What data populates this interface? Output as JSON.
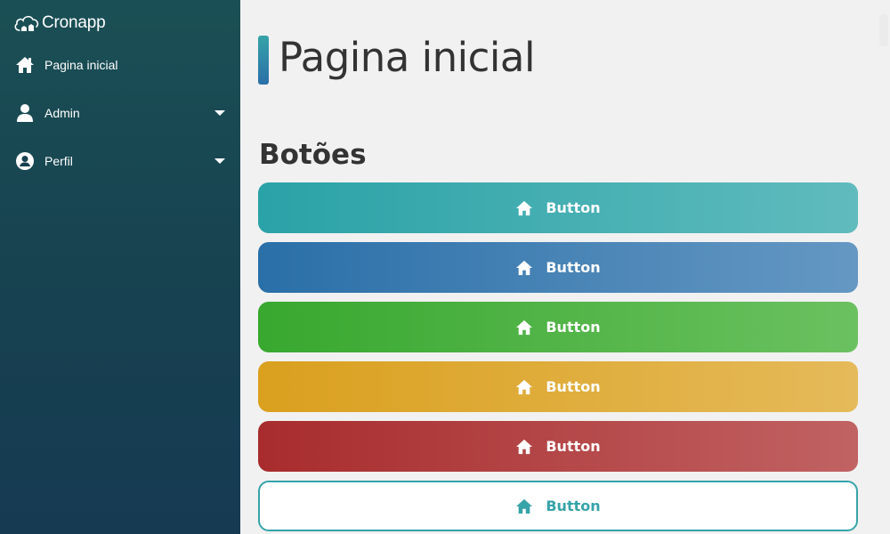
{
  "app": {
    "brand_name": "Cronapp"
  },
  "sidebar": {
    "items": [
      {
        "label": "Pagina inicial",
        "icon": "home-icon",
        "has_submenu": false
      },
      {
        "label": "Admin",
        "icon": "user-icon",
        "has_submenu": true
      },
      {
        "label": "Perfil",
        "icon": "user-circle-icon",
        "has_submenu": true
      }
    ]
  },
  "main": {
    "page_title": "Pagina inicial",
    "section_title": "Botões",
    "buttons": [
      {
        "label": "Button",
        "icon": "home-icon",
        "style": "primary-teal",
        "color": "#2aa2a7"
      },
      {
        "label": "Button",
        "icon": "home-icon",
        "style": "blue",
        "color": "#2a6fa8"
      },
      {
        "label": "Button",
        "icon": "home-icon",
        "style": "green",
        "color": "#38a82f"
      },
      {
        "label": "Button",
        "icon": "home-icon",
        "style": "yellow",
        "color": "#daa01e"
      },
      {
        "label": "Button",
        "icon": "home-icon",
        "style": "red",
        "color": "#a82c2d"
      },
      {
        "label": "Button",
        "icon": "home-icon",
        "style": "outline-teal",
        "color": "#36a3a8"
      }
    ]
  }
}
